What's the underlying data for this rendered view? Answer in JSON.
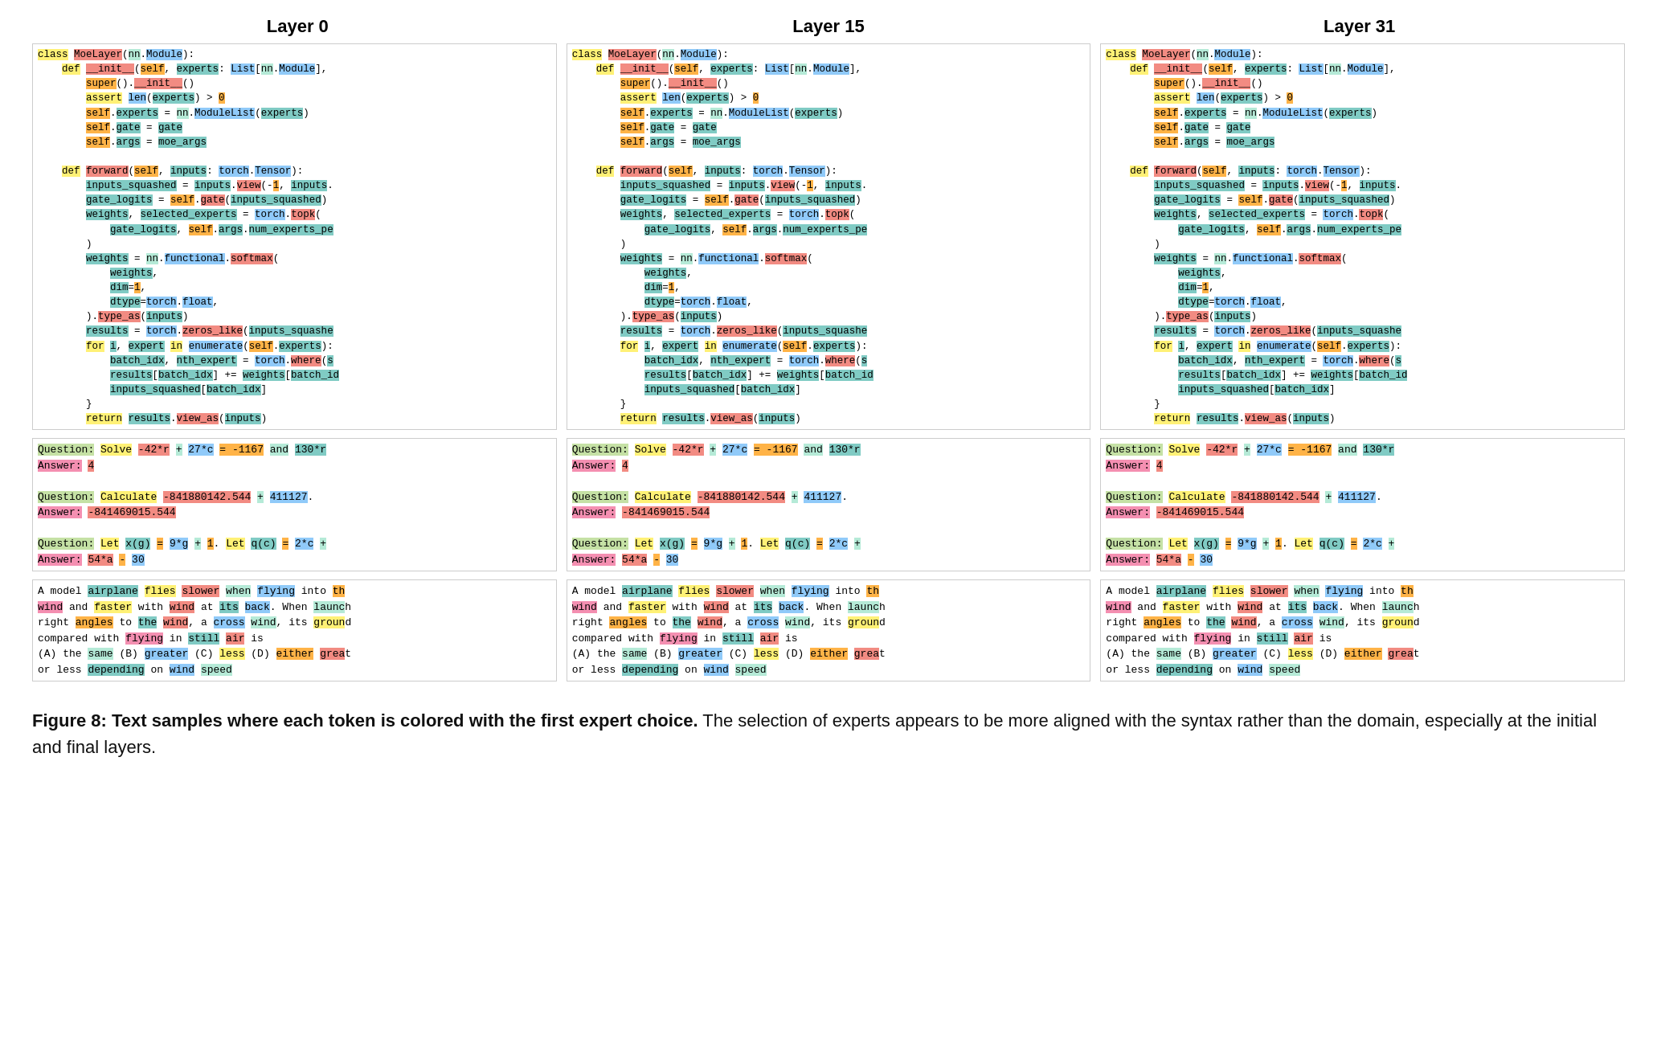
{
  "headers": [
    "Layer 0",
    "Layer 15",
    "Layer 31"
  ],
  "figure_caption_bold": "Figure 8: Text samples where each token is colored with the first expert choice.",
  "figure_caption_normal": " The selection of experts appears to be more aligned with the syntax rather than the domain, especially at the initial and final layers."
}
